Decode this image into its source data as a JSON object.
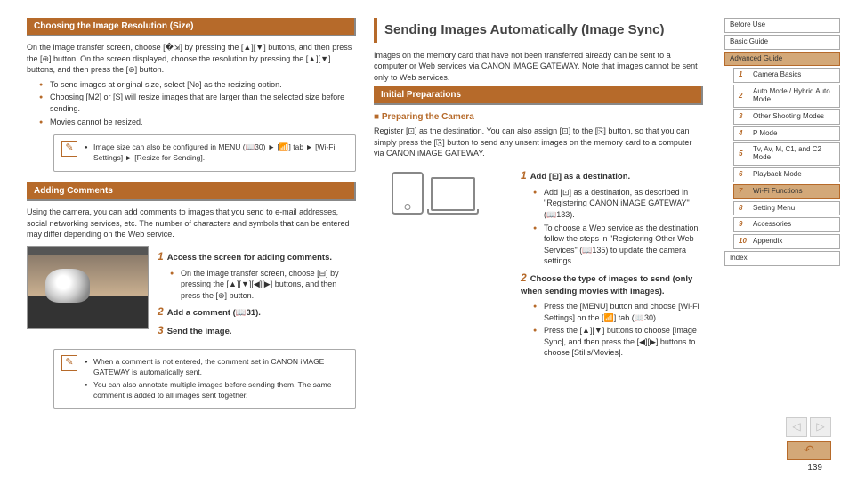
{
  "col1": {
    "h1": "Choosing the Image Resolution (Size)",
    "p1": "On the image transfer screen, choose [�⇲] by pressing the [▲][▼] buttons, and then press the [⊛] button. On the screen displayed, choose the resolution by pressing the [▲][▼] buttons, and then press the [⊛] button.",
    "b1": "To send images at original size, select [No] as the resizing option.",
    "b2": "Choosing [M2] or [S] will resize images that are larger than the selected size before sending.",
    "b3": "Movies cannot be resized.",
    "note1": "Image size can also be configured in MENU (📖30) ► [📶] tab ► [Wi-Fi Settings] ► [Resize for Sending].",
    "h2": "Adding Comments",
    "p2": "Using the camera, you can add comments to images that you send to e-mail addresses, social networking services, etc. The number of characters and symbols that can be entered may differ depending on the Web service.",
    "s1t": "Access the screen for adding comments.",
    "s1b": "On the image transfer screen, choose [⊟] by pressing the [▲][▼][◀][▶] buttons, and then press the [⊛] button.",
    "s2t": "Add a comment (📖31).",
    "s3t": "Send the image.",
    "note2a": "When a comment is not entered, the comment set in CANON iMAGE GATEWAY is automatically sent.",
    "note2b": "You can also annotate multiple images before sending them. The same comment is added to all images sent together."
  },
  "col2": {
    "title": "Sending Images Automatically (Image Sync)",
    "p1": "Images on the memory card that have not been transferred already can be sent to a computer or Web services via CANON iMAGE GATEWAY. Note that images cannot be sent only to Web services.",
    "h1": "Initial Preparations",
    "sub1": "Preparing the Camera",
    "p2": "Register [⊡] as the destination. You can also assign [⊡] to the [⎘] button, so that you can simply press the [⎘] button to send any unsent images on the memory card to a computer via CANON iMAGE GATEWAY.",
    "s1t": "Add [⊡] as a destination.",
    "s1b1": "Add [⊡] as a destination, as described in \"Registering CANON iMAGE GATEWAY\" (📖133).",
    "s1b2": "To choose a Web service as the destination, follow the steps in \"Registering Other Web Services\" (📖135) to update the camera settings.",
    "s2t": "Choose the type of images to send (only when sending movies with images).",
    "s2b1": "Press the [MENU] button and choose [Wi-Fi Settings] on the [📶] tab (📖30).",
    "s2b2": "Press the [▲][▼] buttons to choose [Image Sync], and then press the [◀][▶] buttons to choose [Stills/Movies]."
  },
  "sidebar": {
    "items": [
      {
        "label": "Before Use"
      },
      {
        "label": "Basic Guide"
      },
      {
        "label": "Advanced Guide",
        "active": true
      }
    ],
    "sub": [
      {
        "n": "1",
        "label": "Camera Basics"
      },
      {
        "n": "2",
        "label": "Auto Mode / Hybrid Auto Mode"
      },
      {
        "n": "3",
        "label": "Other Shooting Modes"
      },
      {
        "n": "4",
        "label": "P Mode"
      },
      {
        "n": "5",
        "label": "Tv, Av, M, C1, and C2 Mode"
      },
      {
        "n": "6",
        "label": "Playback Mode"
      },
      {
        "n": "7",
        "label": "Wi-Fi Functions",
        "active": true
      },
      {
        "n": "8",
        "label": "Setting Menu"
      },
      {
        "n": "9",
        "label": "Accessories"
      },
      {
        "n": "10",
        "label": "Appendix"
      }
    ],
    "index": "Index"
  },
  "pagenum": "139"
}
